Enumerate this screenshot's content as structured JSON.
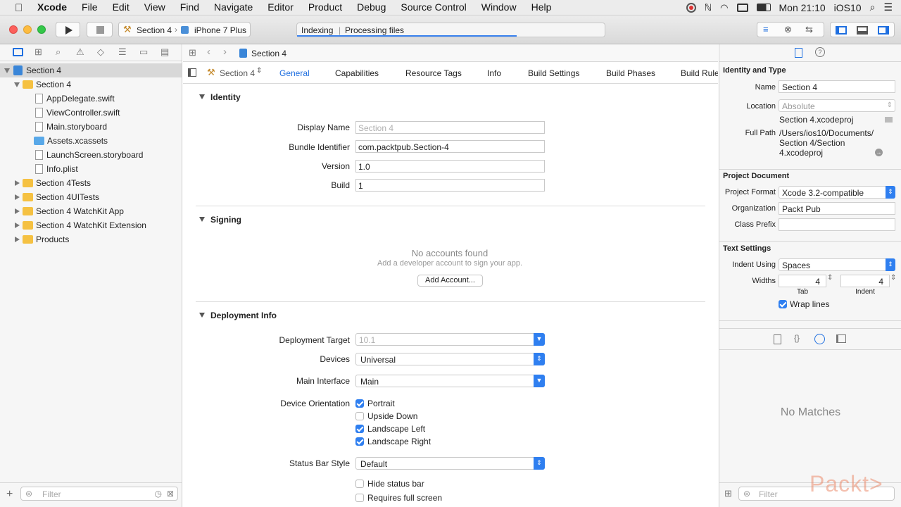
{
  "menubar": {
    "items": [
      "Xcode",
      "File",
      "Edit",
      "View",
      "Find",
      "Navigate",
      "Editor",
      "Product",
      "Debug",
      "Source Control",
      "Window",
      "Help"
    ],
    "clock": "Mon 21:10",
    "user": "iOS10"
  },
  "toolbar": {
    "scheme": "Section 4",
    "device": "iPhone 7 Plus",
    "activity_left": "Indexing",
    "activity_right": "Processing files"
  },
  "navigator": {
    "filter_placeholder": "Filter",
    "tree": [
      {
        "label": "Section 4",
        "level": 0
      },
      {
        "label": "Section 4",
        "level": 1
      },
      {
        "label": "AppDelegate.swift",
        "level": 2
      },
      {
        "label": "ViewController.swift",
        "level": 2
      },
      {
        "label": "Main.storyboard",
        "level": 2
      },
      {
        "label": "Assets.xcassets",
        "level": 2
      },
      {
        "label": "LaunchScreen.storyboard",
        "level": 2
      },
      {
        "label": "Info.plist",
        "level": 2
      },
      {
        "label": "Section 4Tests",
        "level": 1
      },
      {
        "label": "Section 4UITests",
        "level": 1
      },
      {
        "label": "Section 4 WatchKit App",
        "level": 1
      },
      {
        "label": "Section 4 WatchKit Extension",
        "level": 1
      },
      {
        "label": "Products",
        "level": 1
      }
    ]
  },
  "editor": {
    "jump_title": "Section 4",
    "target_selector": "Section 4",
    "tabs": [
      "General",
      "Capabilities",
      "Resource Tags",
      "Info",
      "Build Settings",
      "Build Phases",
      "Build Rule"
    ],
    "identity": {
      "heading": "Identity",
      "display_name_label": "Display Name",
      "display_name_placeholder": "Section 4",
      "bundle_id_label": "Bundle Identifier",
      "bundle_id": "com.packtpub.Section-4",
      "version_label": "Version",
      "version": "1.0",
      "build_label": "Build",
      "build": "1"
    },
    "signing": {
      "heading": "Signing",
      "no_accounts": "No accounts found",
      "hint": "Add a developer account to sign your app.",
      "add_button": "Add Account..."
    },
    "deployment": {
      "heading": "Deployment Info",
      "target_label": "Deployment Target",
      "target": "10.1",
      "devices_label": "Devices",
      "devices": "Universal",
      "main_interface_label": "Main Interface",
      "main_interface": "Main",
      "orientation_label": "Device Orientation",
      "orientations": [
        {
          "label": "Portrait",
          "checked": true
        },
        {
          "label": "Upside Down",
          "checked": false
        },
        {
          "label": "Landscape Left",
          "checked": true
        },
        {
          "label": "Landscape Right",
          "checked": true
        }
      ],
      "status_bar_label": "Status Bar Style",
      "status_bar": "Default",
      "hide_status_bar": "Hide status bar",
      "requires_full_screen": "Requires full screen"
    }
  },
  "inspector": {
    "identity_heading": "Identity and Type",
    "name_label": "Name",
    "name": "Section 4",
    "location_label": "Location",
    "location": "Absolute",
    "file_name": "Section 4.xcodeproj",
    "full_path_label": "Full Path",
    "full_path_1": "/Users/ios10/Documents/",
    "full_path_2": "Section 4/Section",
    "full_path_3": "4.xcodeproj",
    "project_doc_heading": "Project Document",
    "format_label": "Project Format",
    "format": "Xcode 3.2-compatible",
    "org_label": "Organization",
    "org": "Packt Pub",
    "prefix_label": "Class Prefix",
    "text_settings_heading": "Text Settings",
    "indent_using_label": "Indent Using",
    "indent_using": "Spaces",
    "widths_label": "Widths",
    "tab_width": "4",
    "indent_width": "4",
    "tab_caption": "Tab",
    "indent_caption": "Indent",
    "wrap_lines": "Wrap lines",
    "no_matches": "No Matches",
    "filter_placeholder": "Filter"
  },
  "watermark": "Packt>"
}
